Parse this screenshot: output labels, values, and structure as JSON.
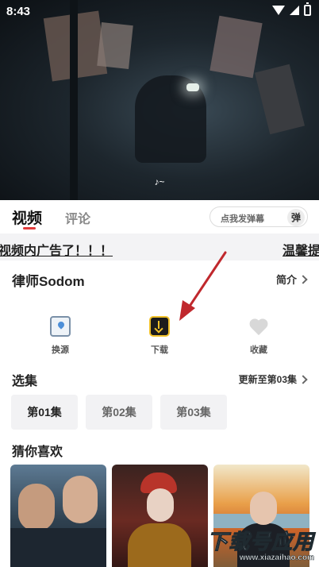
{
  "status_bar": {
    "time": "8:43"
  },
  "video": {
    "subtitle": "♪~"
  },
  "tabs": {
    "video": "视频",
    "comment": "评论"
  },
  "danmaku": {
    "placeholder": "点我发弹幕",
    "button": "弹"
  },
  "notice": {
    "left": "视频内广告了！！！",
    "right": "温馨提"
  },
  "title": {
    "name": "律师Sodom",
    "intro": "简介"
  },
  "actions": [
    {
      "label": "换源",
      "icon": "switch-source-icon"
    },
    {
      "label": "下载",
      "icon": "download-icon"
    },
    {
      "label": "收藏",
      "icon": "favorite-heart-icon"
    }
  ],
  "episodes": {
    "heading": "选集",
    "update": "更新至第03集",
    "items": [
      "第01集",
      "第02集",
      "第03集"
    ]
  },
  "recommend": {
    "heading": "猜你喜欢"
  },
  "watermark": {
    "main": "下载号应用",
    "url": "www.xiazaihao.com"
  },
  "colors": {
    "accent": "#e23a3a",
    "download_icon": "#f0c12a",
    "arrow": "#c0282d"
  }
}
